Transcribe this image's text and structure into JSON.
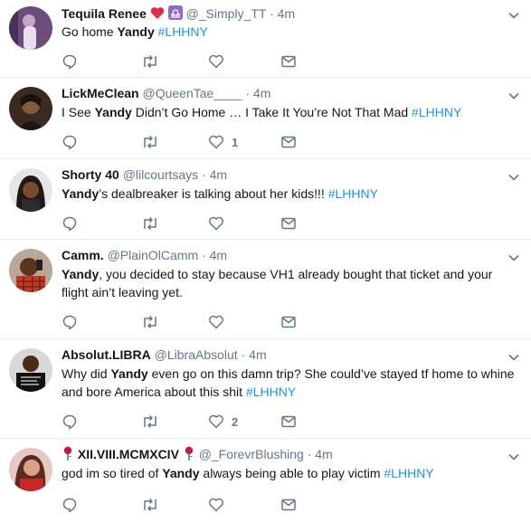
{
  "tweets": [
    {
      "name": "Tequila Renee",
      "handle": "@_Simply_TT",
      "time": "4m",
      "text_parts": [
        "Go home ",
        "Yandy",
        " ",
        "#LHHNY"
      ],
      "reply_count": "",
      "retweet_count": "",
      "like_count": ""
    },
    {
      "name": "LickMeClean",
      "handle": "@QueenTae____",
      "time": "4m",
      "text_parts": [
        "I See ",
        "Yandy",
        " Didn’t Go Home … I Take It You’re Not That Mad ",
        "#LHHNY"
      ],
      "reply_count": "",
      "retweet_count": "",
      "like_count": "1"
    },
    {
      "name": "Shorty 40",
      "handle": "@lilcourtsays",
      "time": "4m",
      "text_parts": [
        "",
        "Yandy",
        "’s dealbreaker is talking about her kids!!! ",
        "#LHHNY"
      ],
      "reply_count": "",
      "retweet_count": "",
      "like_count": ""
    },
    {
      "name": "Camm.",
      "handle": "@PlainOlCamm",
      "time": "4m",
      "text_parts": [
        "",
        "Yandy",
        ", you decided to stay because VH1 already bought that ticket and your flight ain’t leaving yet.",
        ""
      ],
      "reply_count": "",
      "retweet_count": "",
      "like_count": ""
    },
    {
      "name": "Absolut.LIBRA",
      "handle": "@LibraAbsolut",
      "time": "4m",
      "text_parts": [
        "Why did ",
        "Yandy",
        " even go on this damn trip? She could’ve stayed tf home to whine and bore America about this shit  ",
        "#LHHNY"
      ],
      "reply_count": "",
      "retweet_count": "",
      "like_count": "2"
    },
    {
      "name": "XII.VIII.MCMXCIV",
      "handle": "@_ForevrBlushing",
      "time": "4m",
      "text_parts": [
        "god im so tired of ",
        "Yandy",
        " always being able to play victim ",
        "#LHHNY"
      ],
      "reply_count": "",
      "retweet_count": "",
      "like_count": ""
    }
  ],
  "dot": "·",
  "colors": {
    "link": "#1b95e0",
    "muted": "#657786",
    "divider": "#e6ecf0"
  }
}
